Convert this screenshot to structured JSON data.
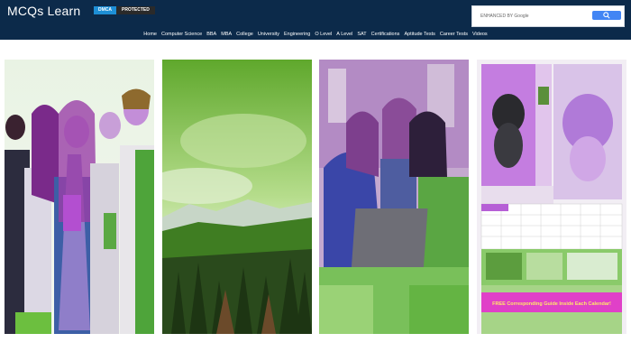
{
  "site": {
    "logo_text": "MCQs Learn"
  },
  "badges": {
    "dmca": "DMCA",
    "protected": "PROTECTED"
  },
  "search": {
    "placeholder": "ENHANCED BY Google",
    "button_icon": "search-icon"
  },
  "nav": {
    "items": [
      "Home",
      "Computer Science",
      "BBA",
      "MBA",
      "College",
      "University",
      "Engineering",
      "O Level",
      "A Level",
      "SAT",
      "Certifications",
      "Aptitude Tests",
      "Career Tests",
      "Videos"
    ]
  },
  "cards": [
    {
      "subject": "group-of-students-image"
    },
    {
      "subject": "forest-landscape-image"
    },
    {
      "subject": "students-with-laptop-image"
    },
    {
      "subject": "calendar-collage-image",
      "banner_text": "FREE Corresponding Guide Inside Each Calendar!"
    }
  ],
  "colors": {
    "header_bg": "#0c2a4a",
    "dmca": "#1e8fd6",
    "protected": "#2a2a2a",
    "search_button": "#4285f4",
    "image_purple": "#b45ad8",
    "image_green": "#3ea62a"
  }
}
